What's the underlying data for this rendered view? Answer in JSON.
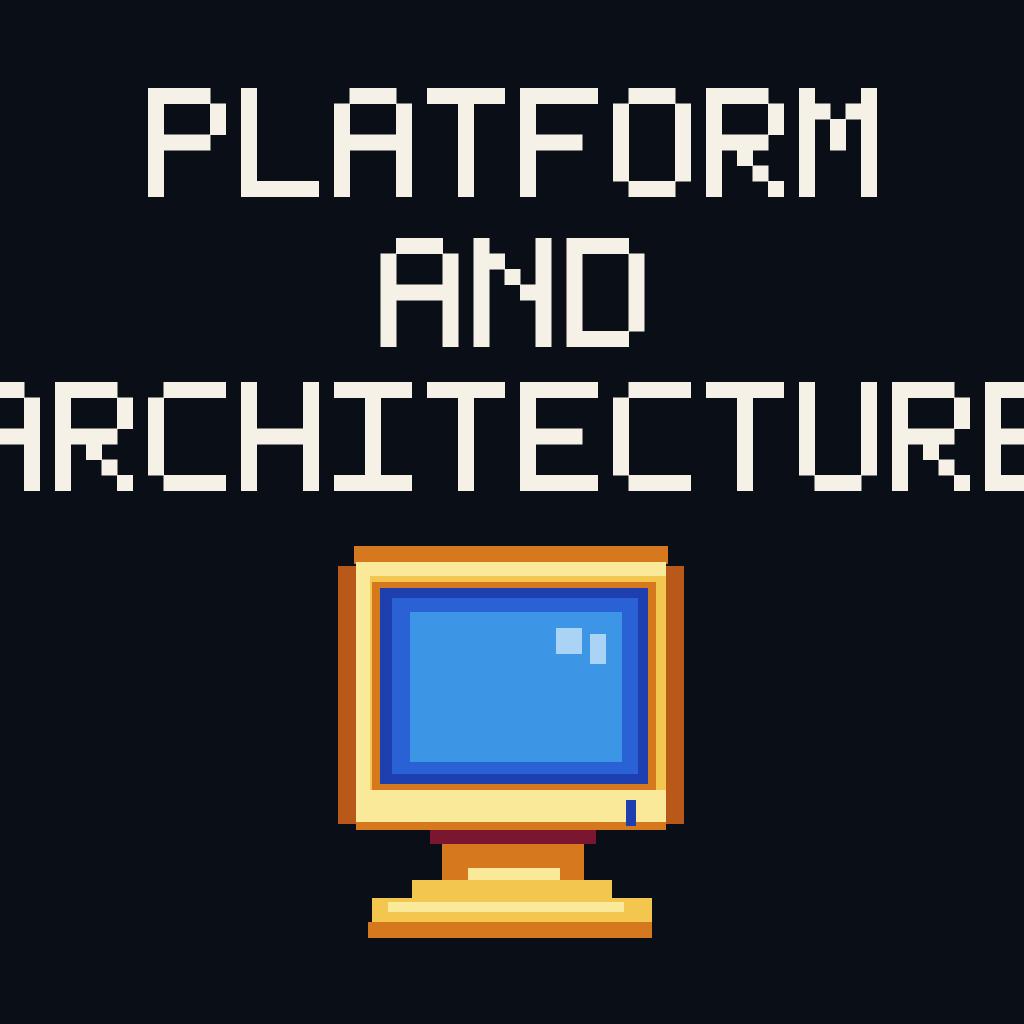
{
  "title": {
    "lines": [
      "PLATFORM",
      "AND",
      "ARCHITECTURE"
    ]
  },
  "icon": {
    "name": "retro-computer-monitor-icon"
  },
  "colors": {
    "background": "#0a0f17",
    "text": "#f5f1e6",
    "frame_light": "#fbe99a",
    "frame_mid": "#f2c64f",
    "frame_dark": "#d6781e",
    "frame_outline": "#b8591a",
    "screen_dark": "#1d3fb0",
    "screen_mid": "#2a62d6",
    "screen_light": "#3d95e6",
    "screen_highlight": "#a9d4f5",
    "neck": "#7a1630"
  }
}
